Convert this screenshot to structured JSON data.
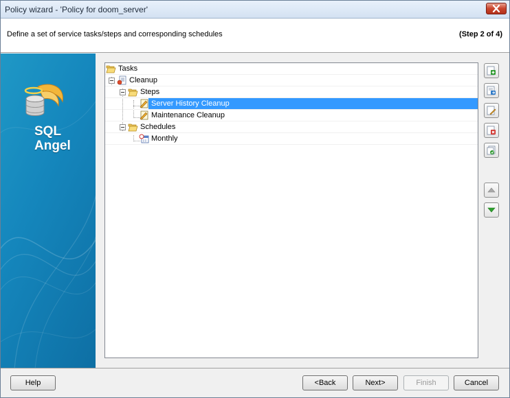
{
  "window": {
    "title": "Policy wizard - 'Policy for doom_server'"
  },
  "header": {
    "description": "Define a set of service tasks/steps and corresponding schedules",
    "step": "(Step 2 of 4)"
  },
  "branding": {
    "logo_line1": "SQL",
    "logo_line2": "Angel"
  },
  "tree": {
    "root": "Tasks",
    "task": "Cleanup",
    "steps_folder": "Steps",
    "steps": [
      "Server History Cleanup",
      "Maintenance Cleanup"
    ],
    "schedules_folder": "Schedules",
    "schedules": [
      "Monthly"
    ],
    "selected": "Server History Cleanup"
  },
  "toolbar": {
    "icons": [
      "add-icon",
      "add-step-icon",
      "edit-icon",
      "delete-icon",
      "copy-icon",
      "move-up-icon",
      "move-down-icon"
    ]
  },
  "buttons": {
    "help": "Help",
    "back": "<Back",
    "next": "Next>",
    "finish": "Finish",
    "cancel": "Cancel"
  },
  "colors": {
    "selection": "#3399ff",
    "sidebar": "#1587bd",
    "close": "#c9442c"
  }
}
